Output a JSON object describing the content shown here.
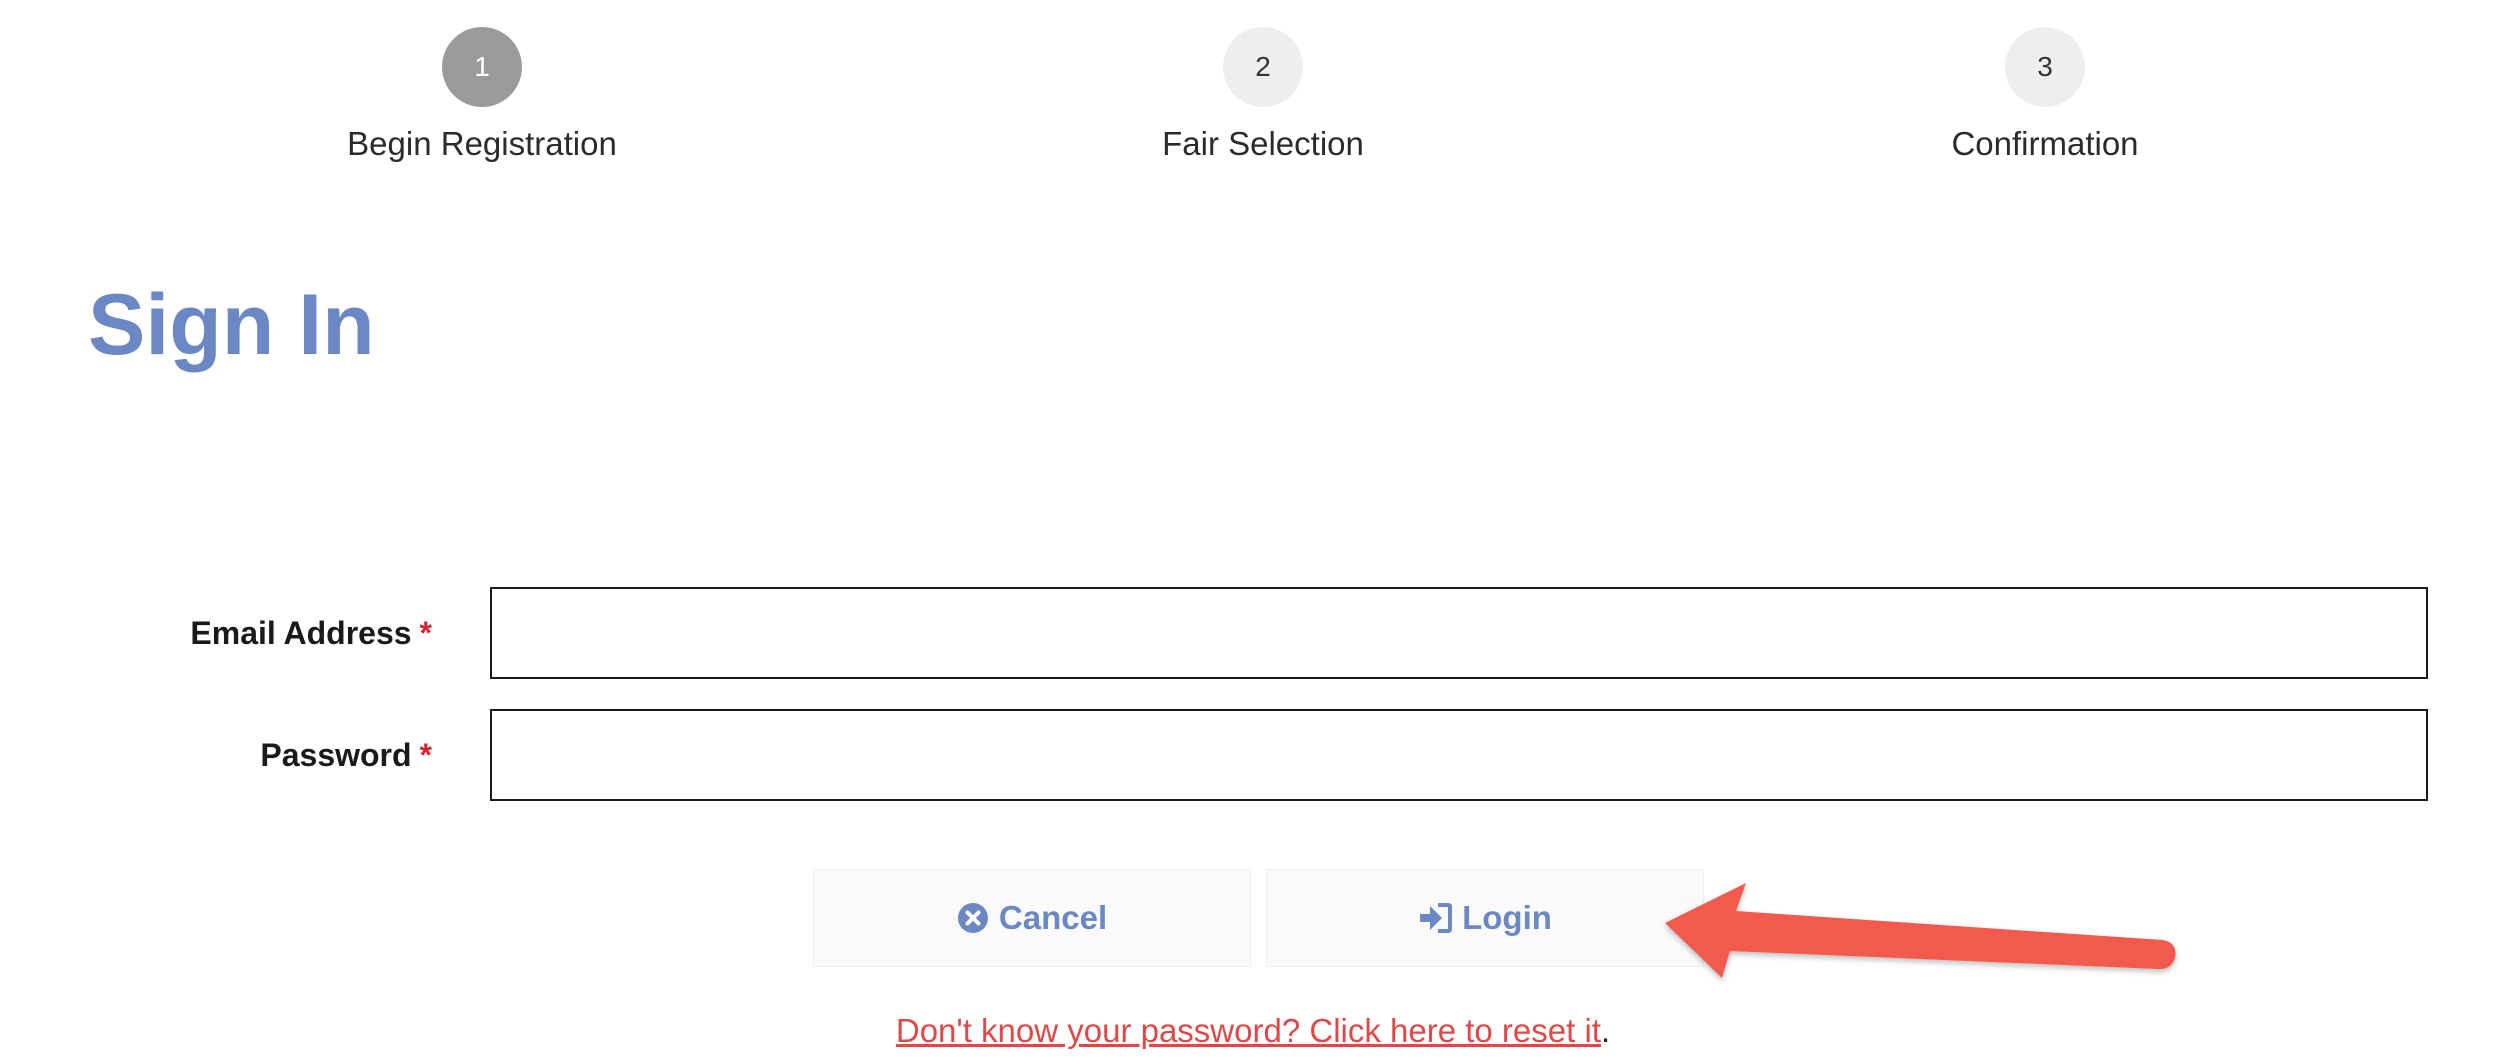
{
  "stepper": {
    "steps": [
      {
        "number": "1",
        "label": "Begin Registration",
        "state": "active"
      },
      {
        "number": "2",
        "label": "Fair Selection",
        "state": "upcoming"
      },
      {
        "number": "3",
        "label": "Confirmation",
        "state": "upcoming"
      }
    ]
  },
  "page": {
    "title": "Sign In"
  },
  "form": {
    "email": {
      "label": "Email Address",
      "required_marker": "*",
      "value": "",
      "placeholder": ""
    },
    "password": {
      "label": "Password",
      "required_marker": "*",
      "value": "",
      "placeholder": ""
    }
  },
  "actions": {
    "cancel": {
      "label": "Cancel",
      "icon": "times-circle-icon"
    },
    "login": {
      "label": "Login",
      "icon": "sign-in-icon"
    }
  },
  "reset": {
    "link_text": "Don't know your password? Click here to reset it",
    "suffix": "."
  },
  "colors": {
    "accent": "#6b88c4",
    "link": "#e04848",
    "required": "#d9232e",
    "annotation_arrow": "#f25a4e",
    "active_step": "#9a9a9a",
    "inactive_step": "#eeeeee"
  }
}
